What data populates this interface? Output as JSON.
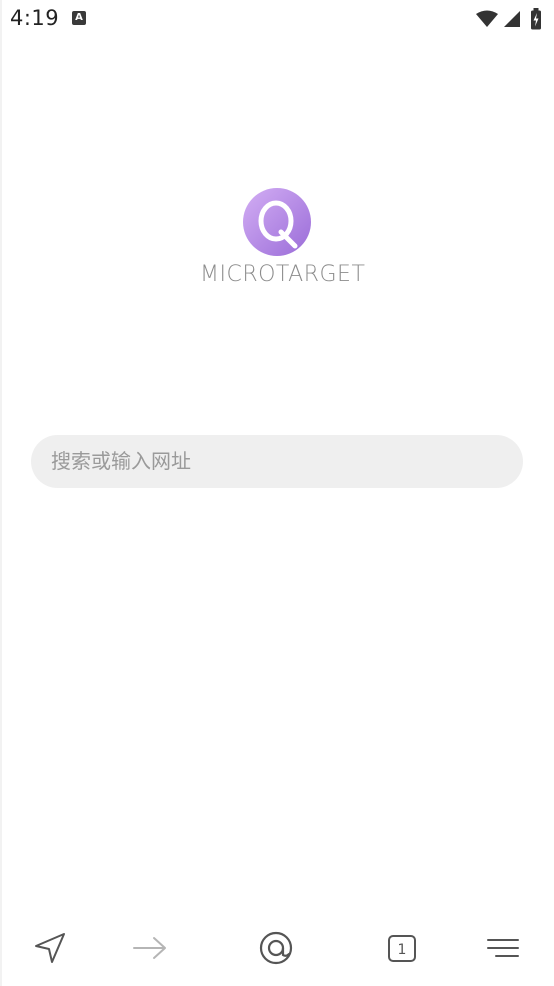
{
  "status_bar": {
    "time": "4:19",
    "notification_letter": "A",
    "icons": [
      "notification-a-icon",
      "wifi-icon",
      "signal-icon",
      "battery-charging-icon"
    ]
  },
  "logo": {
    "letter": "Q",
    "brand": "MICROTARGET",
    "colors": {
      "gradient_start": "#c9a2ef",
      "gradient_end": "#9b6fd9"
    }
  },
  "search": {
    "placeholder": "搜索或输入网址"
  },
  "bottom_nav": {
    "items": [
      {
        "name": "navigate-icon"
      },
      {
        "name": "forward-arrow-icon"
      },
      {
        "name": "home-at-icon"
      },
      {
        "name": "tabs-icon",
        "count": "1"
      },
      {
        "name": "menu-icon"
      }
    ]
  },
  "colors": {
    "background": "#ffffff",
    "search_bg": "#efefef",
    "placeholder": "#9a9a9a",
    "icon": "#555555",
    "icon_disabled": "#b5b5b5"
  }
}
